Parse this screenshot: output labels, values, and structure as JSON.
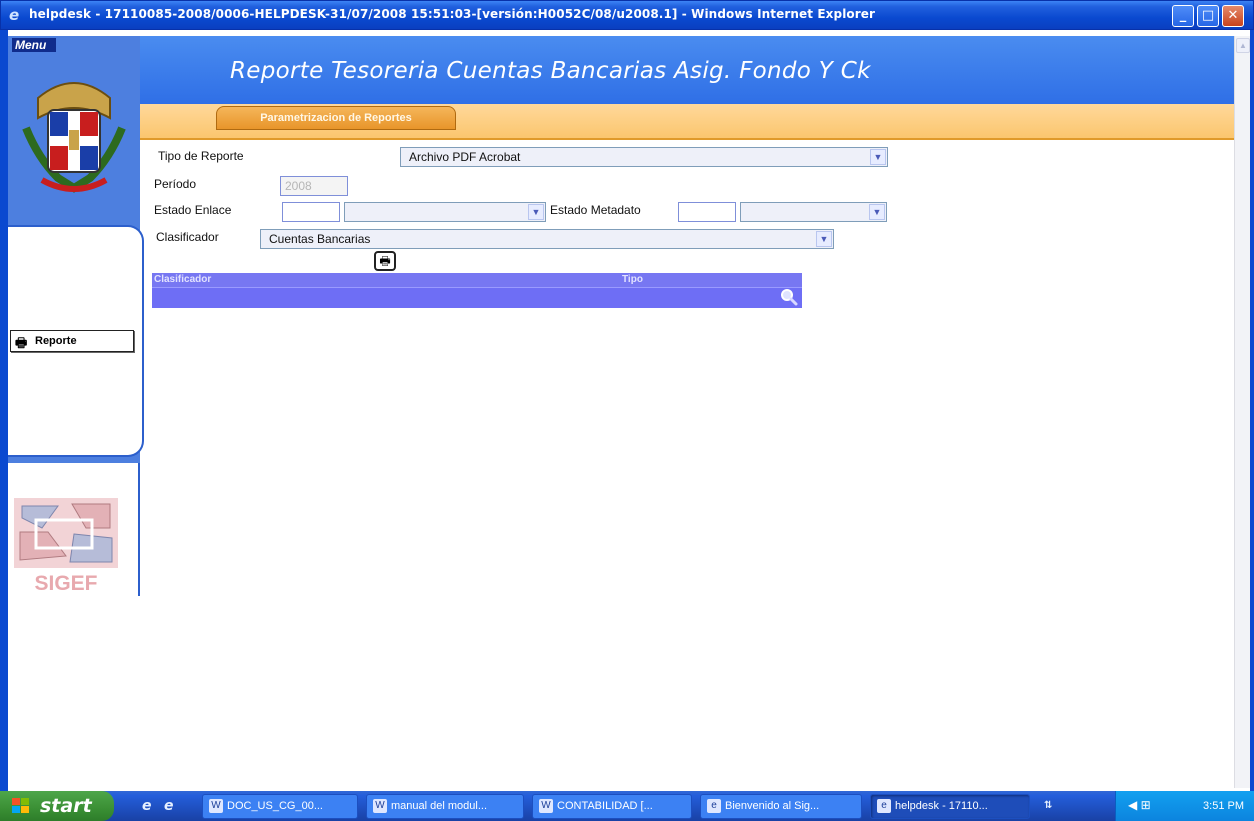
{
  "window": {
    "title": "helpdesk - 17110085-2008/0006-HELPDESK-31/07/2008 15:51:03-[versión:H0052C/08/u2008.1] - Windows Internet Explorer",
    "buttons": {
      "minimize": "_",
      "maximize": "□",
      "close": "✕"
    }
  },
  "menu": {
    "label": "Menu",
    "toolbar_icons": [
      "document-icon",
      "refresh-icon",
      "help-icon",
      "home-icon"
    ],
    "report_button": "Reporte",
    "logo_text": "SIGEF"
  },
  "header": {
    "page_title": "Reporte Tesoreria Cuentas Bancarias Asig. Fondo Y Ck",
    "tab": "Parametrizacion de Reportes"
  },
  "form": {
    "tipo_reporte": {
      "label": "Tipo de Reporte",
      "value": "Archivo PDF Acrobat"
    },
    "periodo": {
      "label": "Período",
      "value": "2008"
    },
    "estado_enlace": {
      "label": "Estado Enlace",
      "code": "",
      "value": ""
    },
    "estado_metadato": {
      "label": "Estado Metadato",
      "code": "",
      "value": ""
    },
    "clasificador": {
      "label": "Clasificador",
      "value": "Cuentas Bancarias"
    }
  },
  "grid": {
    "columns": [
      "Clasificador",
      "Tipo"
    ]
  },
  "taskbar": {
    "start": "start",
    "tasks": [
      {
        "label": "DOC_US_CG_00...",
        "icon": "word-icon",
        "active": false
      },
      {
        "label": "manual del modul...",
        "icon": "word-icon",
        "active": false
      },
      {
        "label": "CONTABILIDAD [...",
        "icon": "word-icon",
        "active": false
      },
      {
        "label": "Bienvenido al Sig...",
        "icon": "ie-icon",
        "active": false
      },
      {
        "label": "helpdesk - 17110...",
        "icon": "ie-icon",
        "active": true
      }
    ],
    "clock": "3:51 PM"
  },
  "colors": {
    "header_blue": "#2f6fe6",
    "tab_orange": "#fbc66e",
    "grid_purple": "#7777f2",
    "taskbar_blue": "#245edb",
    "start_green": "#3a8f34"
  }
}
